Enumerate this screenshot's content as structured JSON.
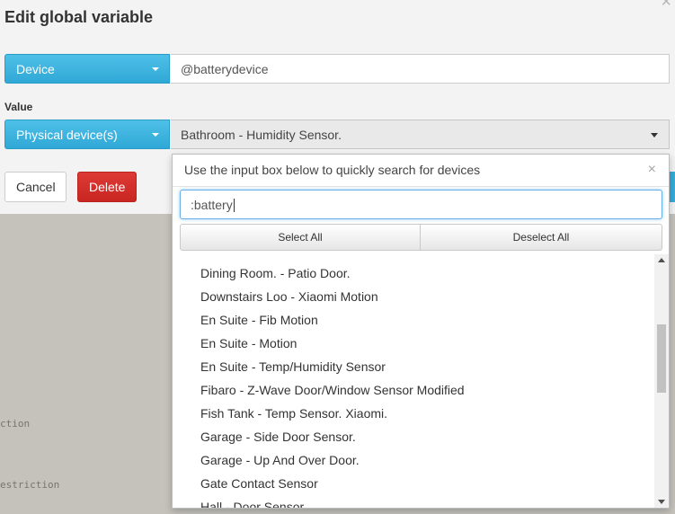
{
  "background": {
    "fragments": [
      "ction",
      "estriction"
    ]
  },
  "modal": {
    "title": "Edit global variable",
    "close_glyph": "×",
    "variable_type_dropdown": {
      "label": "Device"
    },
    "variable_name_value": "@batterydevice",
    "value_label": "Value",
    "value_type_dropdown": {
      "label": "Physical device(s)"
    },
    "value_select": {
      "selected": "Bathroom - Humidity Sensor."
    },
    "cancel_label": "Cancel",
    "delete_label": "Delete"
  },
  "device_dropdown": {
    "hint": "Use the input box below to quickly search for devices",
    "close_glyph": "×",
    "search_value": ":battery",
    "select_all_label": "Select All",
    "deselect_all_label": "Deselect All",
    "items": [
      "Dining Room. - Patio Door.",
      "Downstairs Loo - Xiaomi Motion",
      "En Suite - Fib Motion",
      "En Suite - Motion",
      "En Suite - Temp/Humidity Sensor",
      "Fibaro - Z-Wave Door/Window Sensor Modified",
      "Fish Tank - Temp Sensor. Xiaomi.",
      "Garage - Side Door Sensor.",
      "Garage - Up And Over Door.",
      "Gate Contact Sensor",
      "Hall - Door Sensor"
    ]
  },
  "colors": {
    "primary": "#3db5e0",
    "danger": "#d9302c",
    "backdrop": "#c4c2bb"
  }
}
